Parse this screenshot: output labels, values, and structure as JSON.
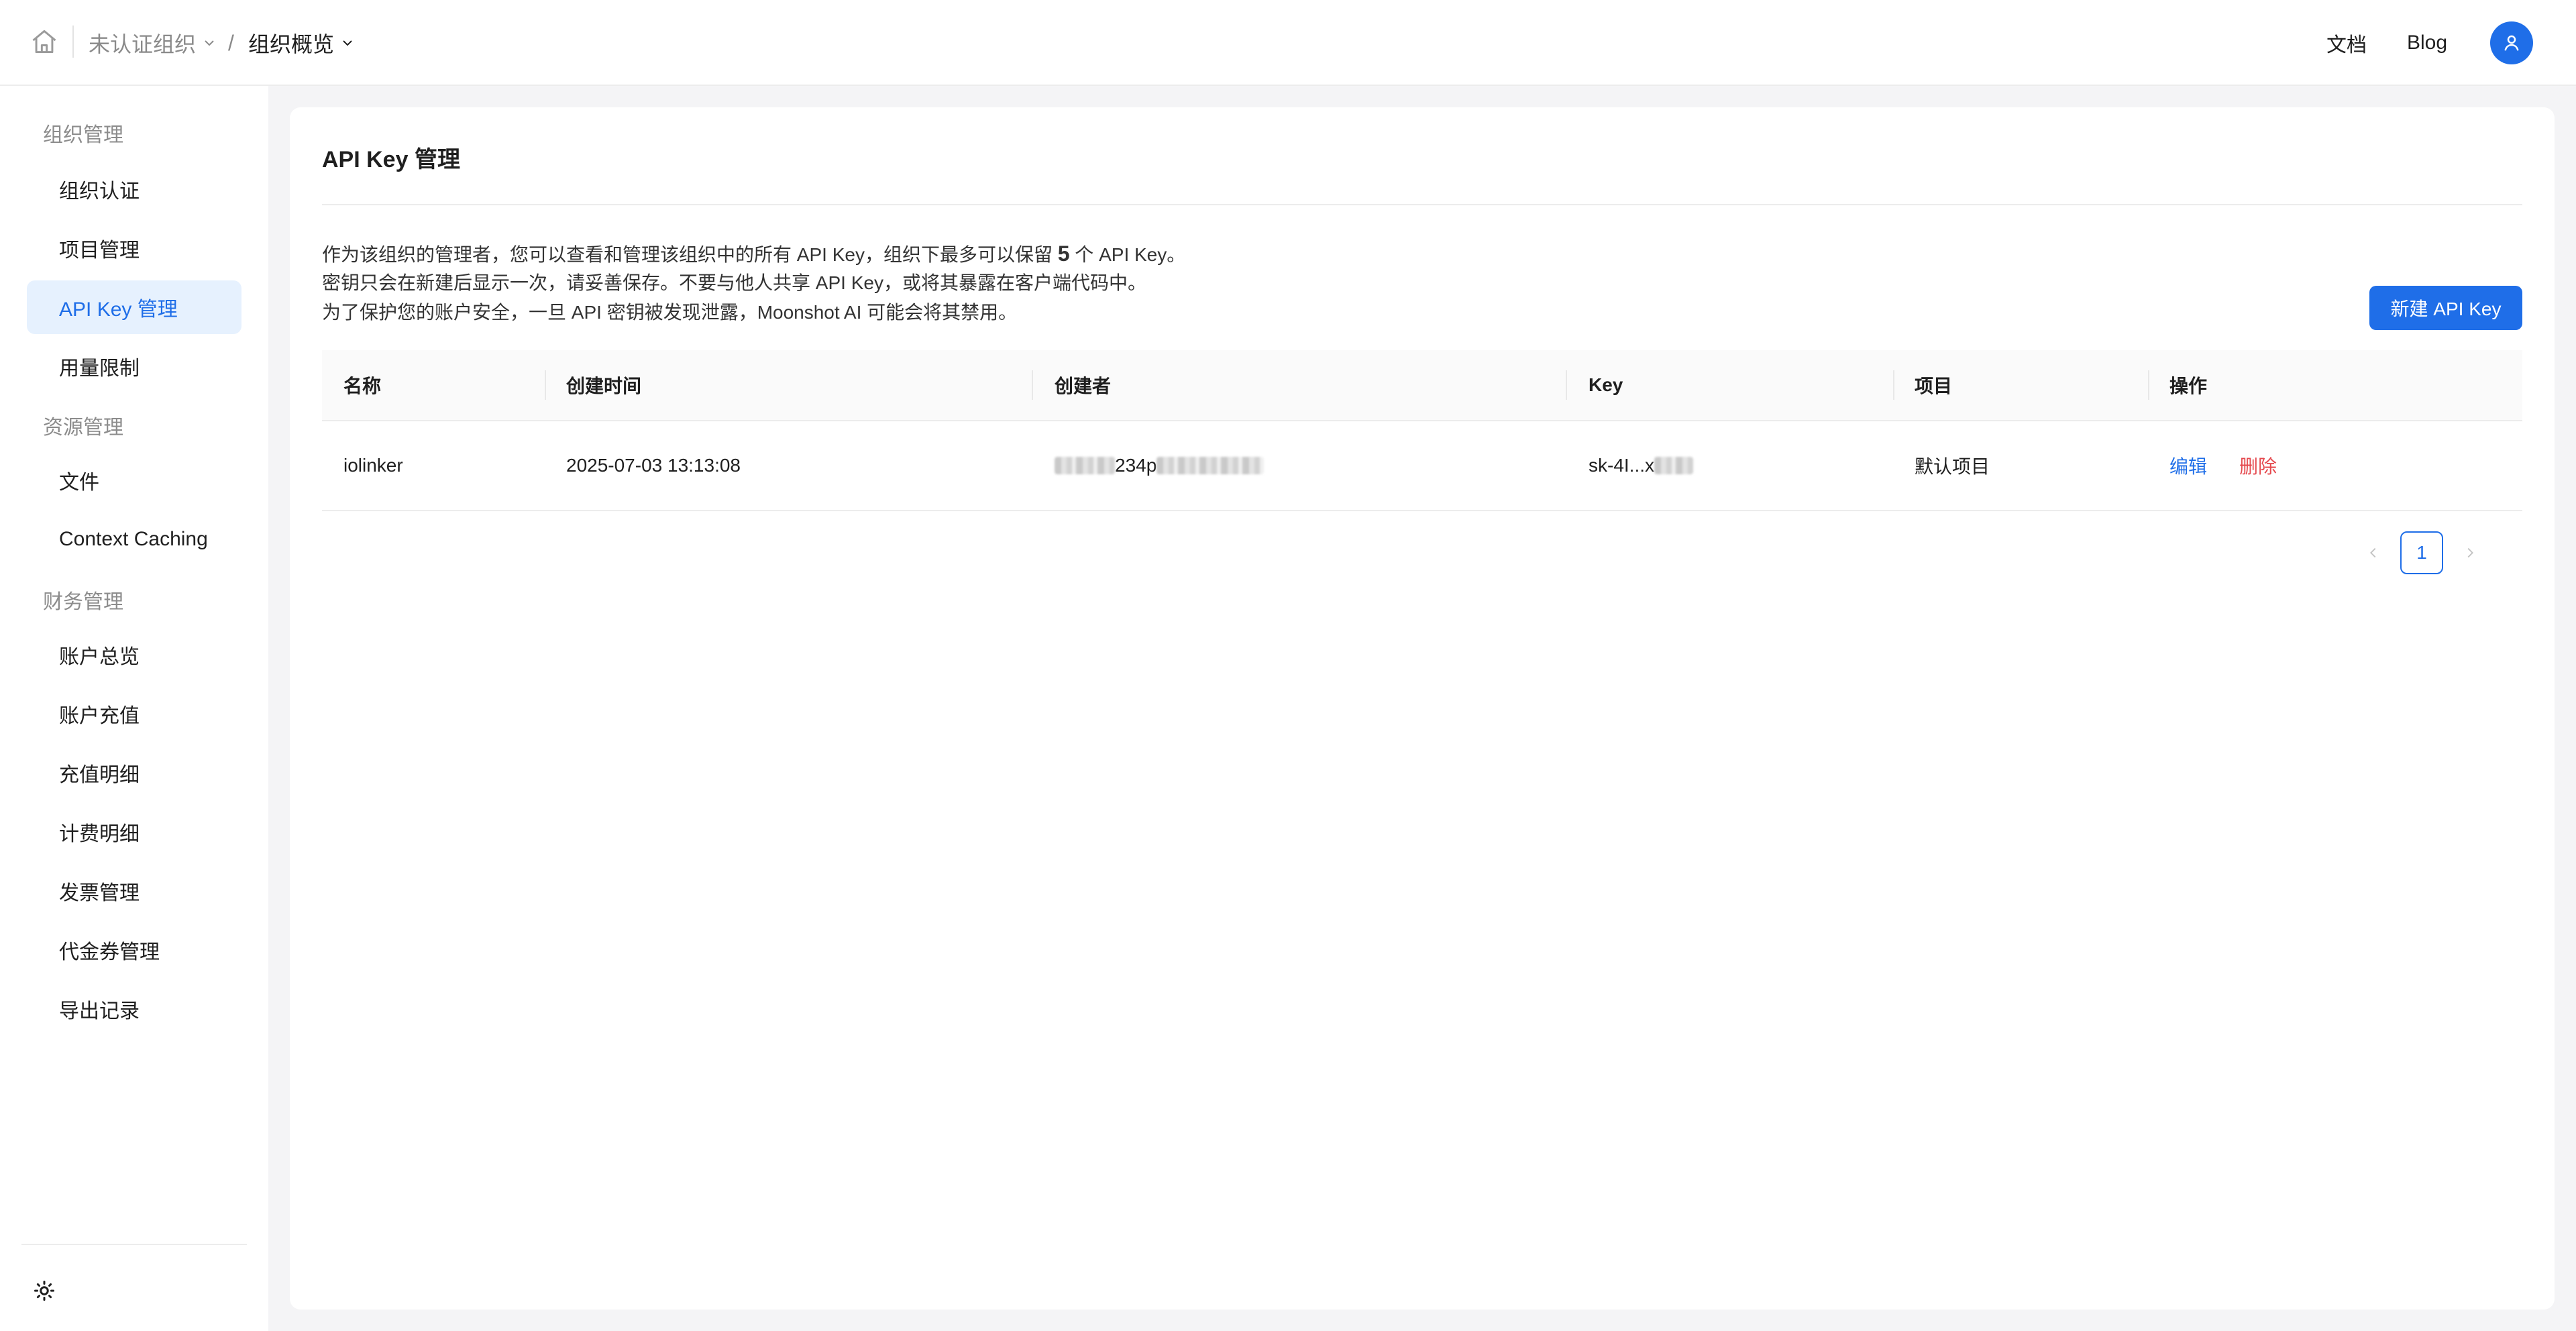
{
  "header": {
    "org_label": "未认证组织",
    "separator": "/",
    "current_label": "组织概览",
    "docs_label": "文档",
    "blog_label": "Blog"
  },
  "sidebar": {
    "groups": [
      {
        "label": "组织管理",
        "items": [
          "组织认证",
          "项目管理",
          "API Key 管理",
          "用量限制"
        ]
      },
      {
        "label": "资源管理",
        "items": [
          "文件",
          "Context Caching"
        ]
      },
      {
        "label": "财务管理",
        "items": [
          "账户总览",
          "账户充值",
          "充值明细",
          "计费明细",
          "发票管理",
          "代金券管理",
          "导出记录"
        ]
      }
    ],
    "active_item": "API Key 管理"
  },
  "main": {
    "title": "API Key 管理",
    "description": {
      "line1_pre": "作为该组织的管理者，您可以查看和管理该组织中的所有 API Key，组织下最多可以保留 ",
      "line1_count": "5",
      "line1_post": " 个 API Key。",
      "line2": "密钥只会在新建后显示一次，请妥善保存。不要与他人共享 API Key，或将其暴露在客户端代码中。",
      "line3": "为了保护您的账户安全，一旦 API 密钥被发现泄露，Moonshot AI 可能会将其禁用。"
    },
    "new_button_label": "新建 API Key",
    "table": {
      "headers": [
        "名称",
        "创建时间",
        "创建者",
        "Key",
        "项目",
        "操作"
      ],
      "rows": [
        {
          "name": "iolinker",
          "created_at": "2025-07-03 13:13:08",
          "creator_visible": "234p",
          "key_visible": "sk-4I...x",
          "project": "默认项目",
          "edit_label": "编辑",
          "delete_label": "删除"
        }
      ]
    },
    "pagination": {
      "current_page": "1"
    }
  },
  "colors": {
    "accent": "#1f6ee8",
    "danger": "#e5484d",
    "active_bg": "#e6f1fe"
  }
}
